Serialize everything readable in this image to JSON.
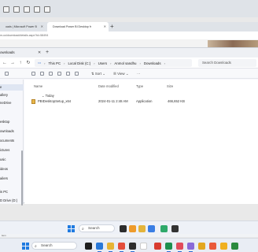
{
  "browser": {
    "tabs": [
      {
        "label": "oads | Microsoft Power B"
      },
      {
        "label": "Download Power BI Desktop fr"
      }
    ],
    "new_tab_label": "+",
    "address": "m-us/download/details.aspx?id=58494"
  },
  "explorer": {
    "title": "ownloads",
    "breadcrumb": [
      "This PC",
      "Local Disk (C:)",
      "Users",
      "Anmol sandhu",
      "Downloads"
    ],
    "search_placeholder": "Search Downloads",
    "toolbar": {
      "sort_label": "Sort",
      "view_label": "View",
      "more_label": "···"
    },
    "sidebar": [
      {
        "label": "e",
        "active": true
      },
      {
        "label": "allery"
      },
      {
        "label": "neDrive"
      },
      {
        "label": "esktop"
      },
      {
        "label": "ownloads"
      },
      {
        "label": "ocuments"
      },
      {
        "label": "ictures"
      },
      {
        "label": "usic"
      },
      {
        "label": "ideos"
      },
      {
        "label": "ailers"
      },
      {
        "label": "is PC"
      },
      {
        "label": "D Drive (D:)"
      }
    ],
    "columns": {
      "name": "Name",
      "date": "Date modified",
      "type": "Type",
      "size": "Size"
    },
    "group": "Today",
    "files": [
      {
        "name": "PBIDesktopSetup_x64",
        "date": "2024-01-11 2:48 AM",
        "type": "Application",
        "size": "466,652 KB"
      }
    ]
  },
  "status": {
    "text": "item"
  },
  "taskbar": {
    "search_label": "Search"
  }
}
